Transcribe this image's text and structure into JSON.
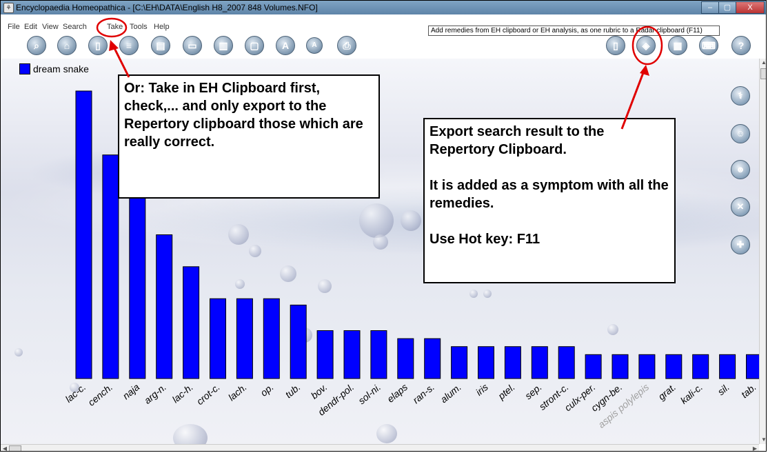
{
  "window": {
    "title": "Encyclopaedia Homeopathica - [C:\\EH\\DATA\\English H8_2007 848 Volumes.NFO]",
    "minimize": "–",
    "maximize": "▢",
    "close": "X"
  },
  "menu": {
    "items": [
      "File",
      "Edit",
      "View",
      "Search",
      "Take",
      "Tools",
      "Help"
    ]
  },
  "tooltip": "Add remedies from EH clipboard or EH analysis, as one rubric to a Radar clipboard (F11)",
  "toolbar": {
    "icons": [
      "book-search-icon",
      "home-icon",
      "columns-icon",
      "document-icon",
      "open-book-icon",
      "card-icon",
      "chart-icon",
      "page-icon",
      "letter-a-icon",
      "letter-a-small-icon",
      "printer-icon"
    ],
    "right_icons": [
      "notebook-icon",
      "export-to-radar-icon",
      "calendar-icon",
      "keyboard-icon",
      "help-icon"
    ],
    "a_label": "A",
    "a_small_label": "A",
    "help_label": "?"
  },
  "legend": {
    "label": "dream snake",
    "color": "#0000ff"
  },
  "callouts": {
    "left": "Or: Take in EH Clipboard first, check,... and only export to the Repertory clipboard those which are really correct.",
    "right_line1": "Export search result to the Repertory Clipboard.",
    "right_line2": "It is added as a symptom with all the remedies.",
    "right_line3": "Use Hot key:  F11"
  },
  "side_icons": [
    "doctor-icon",
    "person-icon",
    "person-color-icon",
    "tools-icon",
    "puzzle-add-icon"
  ],
  "chart_data": {
    "type": "bar",
    "title": "",
    "xlabel": "",
    "ylabel": "",
    "series": [
      {
        "name": "dream snake",
        "color": "#0000ff"
      }
    ],
    "categories": [
      "lac-c.",
      "cench.",
      "naja",
      "arg-n.",
      "lac-h.",
      "crot-c.",
      "lach.",
      "op.",
      "tub.",
      "bov.",
      "dendr-pol.",
      "sol-ni.",
      "elaps",
      "ran-s.",
      "alum.",
      "iris",
      "ptel.",
      "sep.",
      "stront-c.",
      "culx-per.",
      "cygn-be.",
      "aspis polylepis",
      "grat.",
      "kali-c.",
      "sil.",
      "tab."
    ],
    "values": [
      18,
      14,
      14,
      9,
      7,
      5,
      5,
      5,
      4.6,
      3,
      3,
      3,
      2.5,
      2.5,
      2,
      2,
      2,
      2,
      2,
      1.5,
      1.5,
      1.5,
      1.5,
      1.5,
      1.5,
      1.5
    ],
    "ylim": [
      0,
      18
    ]
  }
}
